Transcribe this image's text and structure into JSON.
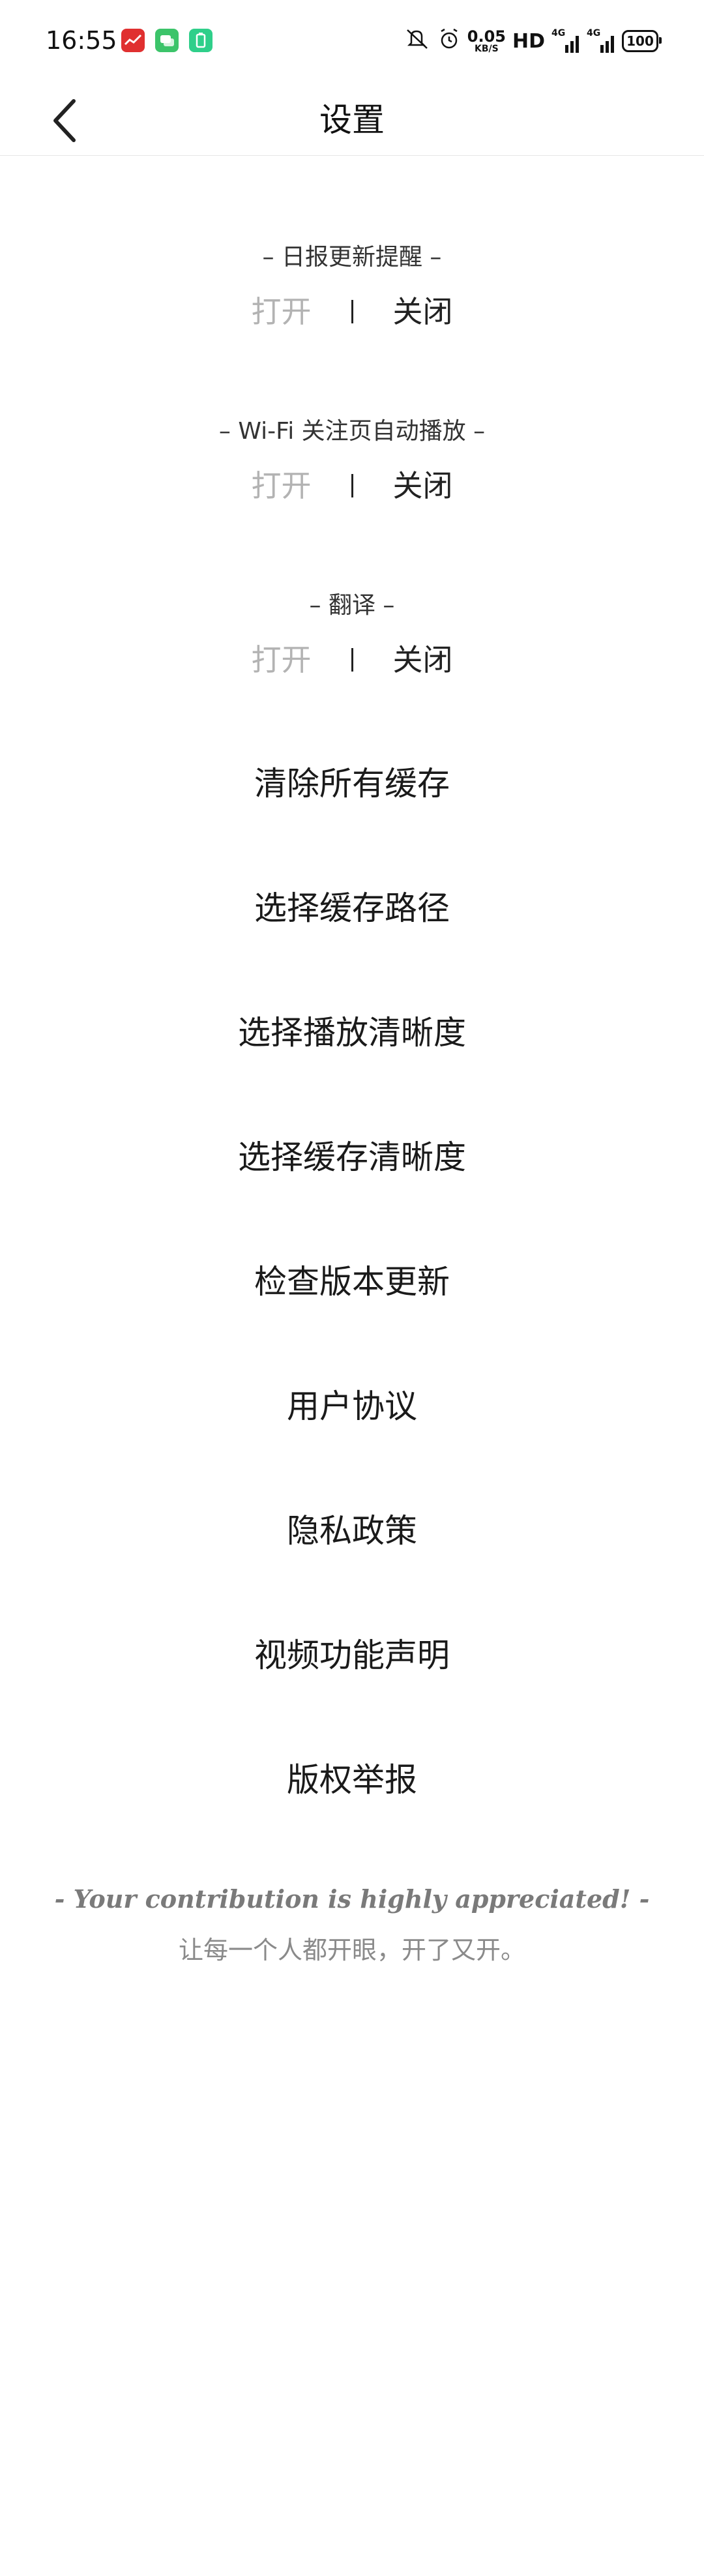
{
  "status_bar": {
    "time": "16:55",
    "net_speed_value": "0.05",
    "net_speed_unit": "KB/S",
    "hd_label": "HD",
    "signal1_label": "4G",
    "signal2_label": "4G",
    "battery": "100",
    "app_icon_colors": [
      "#e03030",
      "#3cc46a",
      "#2fcf8a"
    ]
  },
  "header": {
    "back_icon": "chevron-left-icon",
    "title": "设置"
  },
  "toggles": [
    {
      "title": "– 日报更新提醒 –",
      "on_label": "打开",
      "off_label": "关闭",
      "state": "off"
    },
    {
      "title": "– Wi-Fi 关注页自动播放 –",
      "on_label": "打开",
      "off_label": "关闭",
      "state": "off"
    },
    {
      "title": "– 翻译 –",
      "on_label": "打开",
      "off_label": "关闭",
      "state": "off"
    }
  ],
  "menu": [
    "清除所有缓存",
    "选择缓存路径",
    "选择播放清晰度",
    "选择缓存清晰度",
    "检查版本更新",
    "用户协议",
    "隐私政策",
    "视频功能声明",
    "版权举报"
  ],
  "footer": {
    "quote": "- Your contribution is highly appreciated! -",
    "subtitle": "让每一个人都开眼，开了又开。"
  },
  "colors": {
    "inactive": "#b3b3b3",
    "active": "#222222",
    "divider": "#e6e6e6"
  }
}
